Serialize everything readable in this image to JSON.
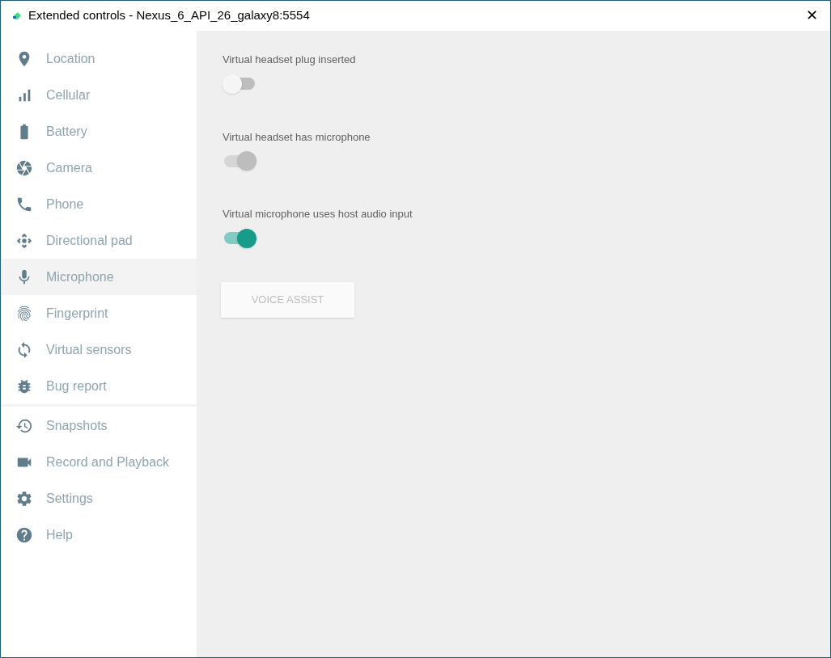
{
  "window": {
    "title": "Extended controls - Nexus_6_API_26_galaxy8:5554",
    "close": "✕"
  },
  "sidebar": {
    "groups": [
      {
        "items": [
          {
            "label": "Location",
            "selected": false
          },
          {
            "label": "Cellular",
            "selected": false
          },
          {
            "label": "Battery",
            "selected": false
          },
          {
            "label": "Camera",
            "selected": false
          },
          {
            "label": "Phone",
            "selected": false
          },
          {
            "label": "Directional pad",
            "selected": false
          },
          {
            "label": "Microphone",
            "selected": true
          },
          {
            "label": "Fingerprint",
            "selected": false
          },
          {
            "label": "Virtual sensors",
            "selected": false
          },
          {
            "label": "Bug report",
            "selected": false
          }
        ]
      },
      {
        "items": [
          {
            "label": "Snapshots",
            "selected": false
          },
          {
            "label": "Record and Playback",
            "selected": false
          },
          {
            "label": "Settings",
            "selected": false
          },
          {
            "label": "Help",
            "selected": false
          }
        ]
      }
    ]
  },
  "toggles": [
    {
      "label": "Virtual headset plug inserted",
      "on": false,
      "disabled": false
    },
    {
      "label": "Virtual headset has microphone",
      "on": true,
      "disabled": true
    },
    {
      "label": "Virtual microphone uses host audio input",
      "on": true,
      "disabled": false
    }
  ],
  "voice_assist": {
    "label": "VOICE ASSIST",
    "disabled": true
  }
}
